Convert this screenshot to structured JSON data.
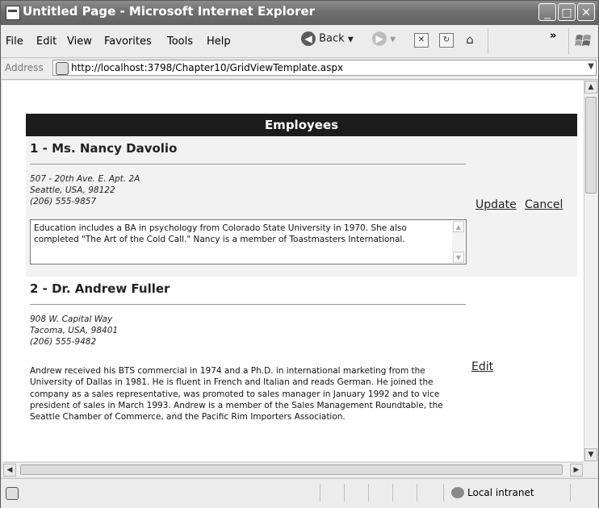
{
  "window": {
    "title": "Untitled Page - Microsoft Internet Explorer",
    "controls": [
      "minimize",
      "maximize",
      "close"
    ]
  },
  "menu": {
    "items": [
      "File",
      "Edit",
      "View",
      "Favorites",
      "Tools",
      "Help"
    ],
    "back_label": "Back",
    "chevron": "»"
  },
  "address": {
    "label": "Address",
    "url": "http://localhost:3798/Chapter10/GridViewTemplate.aspx"
  },
  "grid": {
    "header": "Employees",
    "rows": [
      {
        "title": "1 - Ms. Nancy Davolio",
        "address_line": "507 - 20th Ave. E. Apt. 2A",
        "city_line": "Seattle, USA, 98122",
        "phone": "(206) 555-9857",
        "notes": "Education includes a BA in psychology from Colorado State University in 1970.  She also completed \"The Art of the Cold Call.\"  Nancy is a member of Toastmasters International.",
        "update_label": "Update",
        "cancel_label": "Cancel"
      },
      {
        "title": "2 - Dr. Andrew Fuller",
        "address_line": "908 W. Capital Way",
        "city_line": "Tacoma, USA, 98401",
        "phone": "(206) 555-9482",
        "notes": "Andrew received his BTS commercial in 1974 and a Ph.D. in international marketing from the University of Dallas in 1981. He is fluent in French and Italian and reads German. He joined the company as a sales representative, was promoted to sales manager in January 1992 and to vice president of sales in March 1993. Andrew is a member of the Sales Management Roundtable, the Seattle Chamber of Commerce, and the Pacific Rim Importers Association.",
        "edit_label": "Edit"
      }
    ]
  },
  "status": {
    "zone": "Local intranet"
  }
}
